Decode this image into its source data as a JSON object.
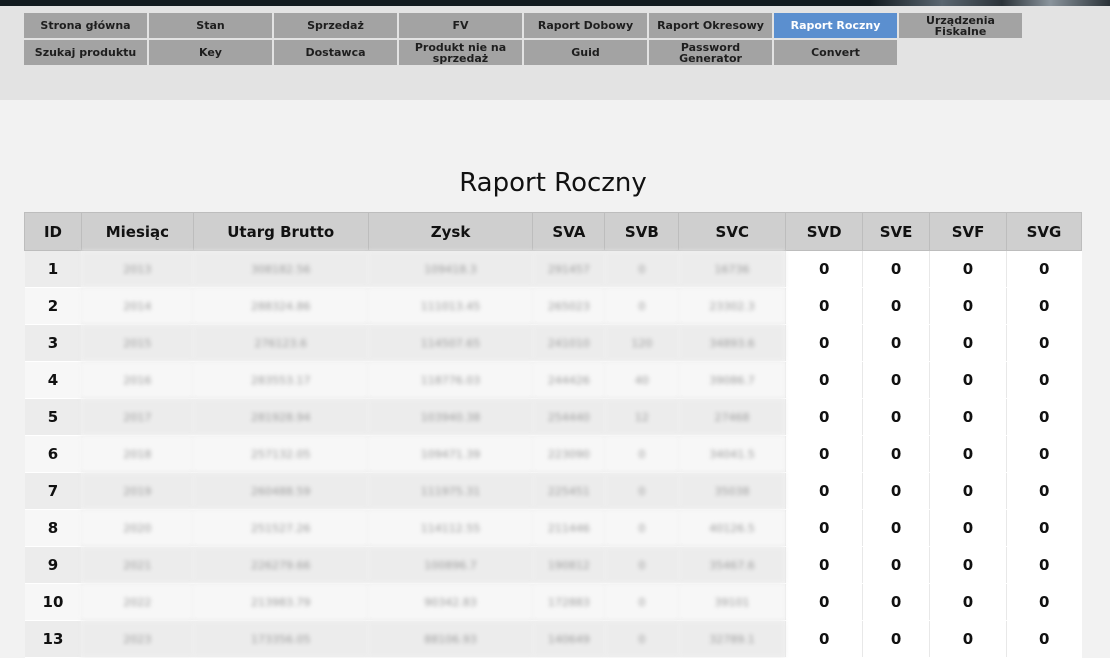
{
  "nav": {
    "row1": [
      "Strona główna",
      "Stan",
      "Sprzedaż",
      "FV",
      "Raport Dobowy",
      "Raport Okresowy",
      "Raport Roczny",
      "Urządzenia Fiskalne"
    ],
    "row2": [
      "Szukaj produktu",
      "Key",
      "Dostawca",
      "Produkt nie na sprzedaż",
      "Guid",
      "Password Generator",
      "Convert"
    ],
    "active": "Raport Roczny"
  },
  "page_title": "Raport Roczny",
  "table": {
    "headers": [
      "ID",
      "Miesiąc",
      "Utarg Brutto",
      "Zysk",
      "SVA",
      "SVB",
      "SVC",
      "SVD",
      "SVE",
      "SVF",
      "SVG"
    ],
    "rows": [
      [
        "1",
        "2013",
        "308182.56",
        "109418.3",
        "291457",
        "0",
        "16736",
        "0",
        "0",
        "0",
        "0"
      ],
      [
        "2",
        "2014",
        "288324.86",
        "111013.45",
        "265023",
        "0",
        "23302.3",
        "0",
        "0",
        "0",
        "0"
      ],
      [
        "3",
        "2015",
        "276123.6",
        "114507.65",
        "241010",
        "120",
        "34893.6",
        "0",
        "0",
        "0",
        "0"
      ],
      [
        "4",
        "2016",
        "283553.17",
        "118776.03",
        "244426",
        "40",
        "39086.7",
        "0",
        "0",
        "0",
        "0"
      ],
      [
        "5",
        "2017",
        "281928.94",
        "103940.38",
        "254440",
        "12",
        "27468",
        "0",
        "0",
        "0",
        "0"
      ],
      [
        "6",
        "2018",
        "257132.05",
        "109471.39",
        "223090",
        "0",
        "34041.5",
        "0",
        "0",
        "0",
        "0"
      ],
      [
        "7",
        "2019",
        "260488.59",
        "111975.31",
        "225451",
        "0",
        "35038",
        "0",
        "0",
        "0",
        "0"
      ],
      [
        "8",
        "2020",
        "251527.26",
        "114112.55",
        "211446",
        "0",
        "40126.5",
        "0",
        "0",
        "0",
        "0"
      ],
      [
        "9",
        "2021",
        "226279.66",
        "100896.7",
        "190812",
        "0",
        "35467.6",
        "0",
        "0",
        "0",
        "0"
      ],
      [
        "10",
        "2022",
        "213983.79",
        "90342.83",
        "172883",
        "0",
        "39101",
        "0",
        "0",
        "0",
        "0"
      ],
      [
        "13",
        "2023",
        "173356.05",
        "88106.93",
        "140649",
        "0",
        "32789.1",
        "0",
        "0",
        "0",
        "0"
      ]
    ]
  }
}
